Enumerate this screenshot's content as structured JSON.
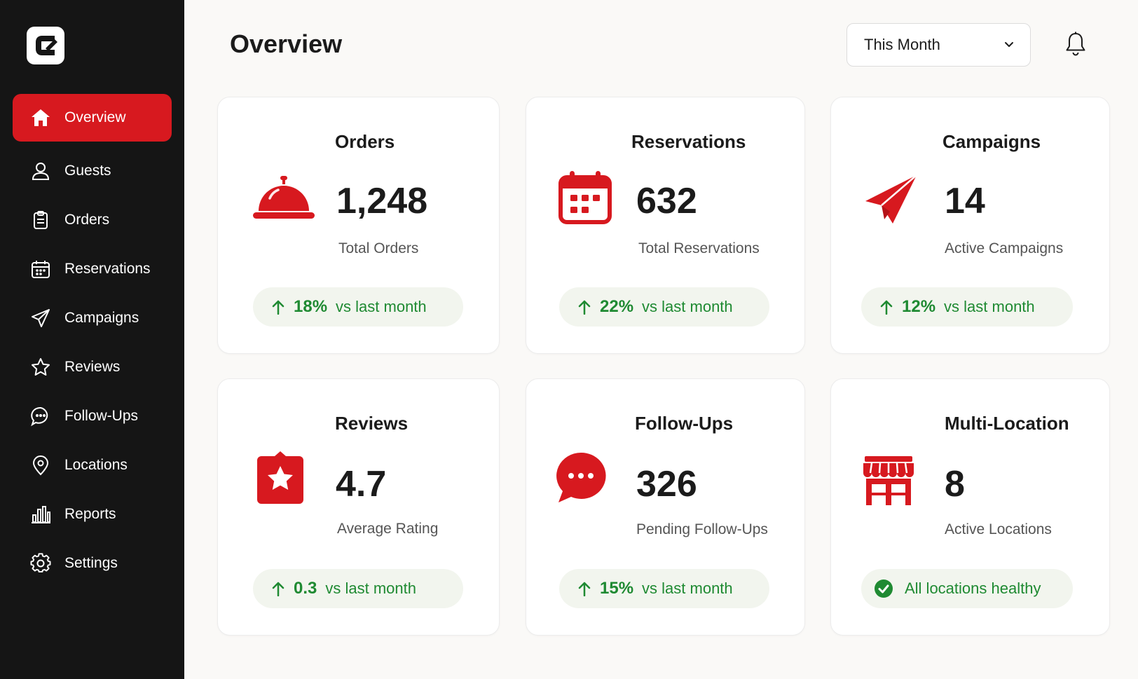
{
  "colors": {
    "accent": "#d7191f",
    "sidebar_bg": "#151515",
    "positive": "#1f8a32",
    "trend_bg": "#f2f5ee",
    "page_bg": "#faf9f7"
  },
  "sidebar": {
    "items": [
      {
        "label": "Overview",
        "icon": "home-icon",
        "active": true
      },
      {
        "label": "Guests",
        "icon": "user-icon"
      },
      {
        "label": "Orders",
        "icon": "clipboard-icon"
      },
      {
        "label": "Reservations",
        "icon": "calendar-icon"
      },
      {
        "label": "Campaigns",
        "icon": "paper-plane-icon"
      },
      {
        "label": "Reviews",
        "icon": "star-icon"
      },
      {
        "label": "Follow-Ups",
        "icon": "chat-bubble-icon"
      },
      {
        "label": "Locations",
        "icon": "map-pin-icon"
      },
      {
        "label": "Reports",
        "icon": "bar-chart-icon"
      },
      {
        "label": "Settings",
        "icon": "gear-icon"
      }
    ]
  },
  "header": {
    "title": "Overview",
    "period": "This Month"
  },
  "cards": [
    {
      "title": "Orders",
      "value": "1,248",
      "label": "Total Orders",
      "icon": "service-bell-icon",
      "trend_pct": "18%",
      "trend_text": "vs last month"
    },
    {
      "title": "Reservations",
      "value": "632",
      "label": "Total Reservations",
      "icon": "calendar-icon",
      "trend_pct": "22%",
      "trend_text": "vs last month"
    },
    {
      "title": "Campaigns",
      "value": "14",
      "label": "Active Campaigns",
      "icon": "paper-plane-icon",
      "trend_pct": "12%",
      "trend_text": "vs last month"
    },
    {
      "title": "Reviews",
      "value": "4.7",
      "label": "Average Rating",
      "icon": "star-badge-icon",
      "trend_pct": "0.3",
      "trend_text": "vs last month"
    },
    {
      "title": "Follow-Ups",
      "value": "326",
      "label": "Pending Follow-Ups",
      "icon": "chat-bubble-icon",
      "trend_pct": "15%",
      "trend_text": "vs last month"
    },
    {
      "title": "Multi-Location",
      "value": "8",
      "label": "Active Locations",
      "icon": "storefront-icon",
      "status_text": "All locations healthy"
    }
  ]
}
